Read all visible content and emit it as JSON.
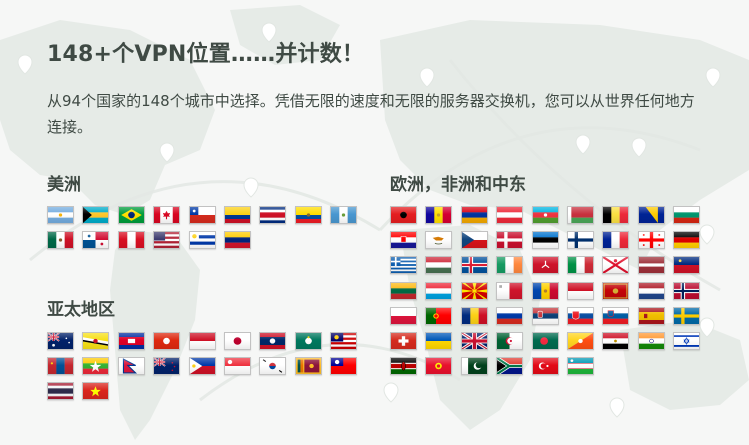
{
  "headline": "148+个VPN位置……并计数！",
  "description": "从94个国家的148个城市中选择。凭借无限的速度和无限的服务器交换机，您可以从世界任何地方连接。",
  "colors": {
    "background": "#f6f7f6",
    "map_land": "#e6ebe7",
    "text": "#3f4a44"
  },
  "regions": {
    "americas": {
      "title": "美洲",
      "flags": [
        "argentina-flag",
        "bahamas-flag",
        "brazil-flag",
        "canada-flag",
        "chile-flag",
        "colombia-flag",
        "costa-rica-flag",
        "ecuador-flag",
        "guatemala-flag",
        "mexico-flag",
        "panama-flag",
        "peru-flag",
        "usa-flag",
        "uruguay-flag",
        "venezuela-flag"
      ]
    },
    "apac": {
      "title": "亚太地区",
      "flags": [
        "australia-flag",
        "brunei-flag",
        "cambodia-flag",
        "hong-kong-flag",
        "indonesia-flag",
        "japan-flag",
        "laos-flag",
        "macau-flag",
        "malaysia-flag",
        "mongolia-flag",
        "myanmar-flag",
        "nepal-flag",
        "new-zealand-flag",
        "philippines-flag",
        "singapore-flag",
        "south-korea-flag",
        "sri-lanka-flag",
        "taiwan-flag",
        "thailand-flag",
        "vietnam-flag"
      ]
    },
    "emea": {
      "title": "欧洲，非洲和中东",
      "flags": [
        "albania-flag",
        "andorra-flag",
        "armenia-flag",
        "austria-flag",
        "azerbaijan-flag",
        "belarus-flag",
        "belgium-flag",
        "bosnia-flag",
        "bulgaria-flag",
        "croatia-flag",
        "cyprus-flag",
        "czechia-flag",
        "denmark-flag",
        "estonia-flag",
        "finland-flag",
        "france-flag",
        "georgia-flag",
        "germany-flag",
        "greece-flag",
        "hungary-flag",
        "iceland-flag",
        "ireland-flag",
        "isle-of-man-flag",
        "italy-flag",
        "jersey-flag",
        "latvia-flag",
        "liechtenstein-flag",
        "lithuania-flag",
        "luxembourg-flag",
        "north-macedonia-flag",
        "malta-flag",
        "moldova-flag",
        "monaco-flag",
        "montenegro-flag",
        "netherlands-flag",
        "norway-flag",
        "poland-flag",
        "portugal-flag",
        "romania-flag",
        "russia-flag",
        "serbia-flag",
        "slovakia-flag",
        "slovenia-flag",
        "spain-flag",
        "sweden-flag",
        "switzerland-flag",
        "ukraine-flag",
        "uk-flag",
        "algeria-flag",
        "bangladesh-flag",
        "bhutan-flag",
        "egypt-flag",
        "india-flag",
        "israel-flag",
        "kenya-flag",
        "kyrgyzstan-flag",
        "pakistan-flag",
        "south-africa-flag",
        "turkey-flag",
        "uzbekistan-flag"
      ]
    }
  }
}
